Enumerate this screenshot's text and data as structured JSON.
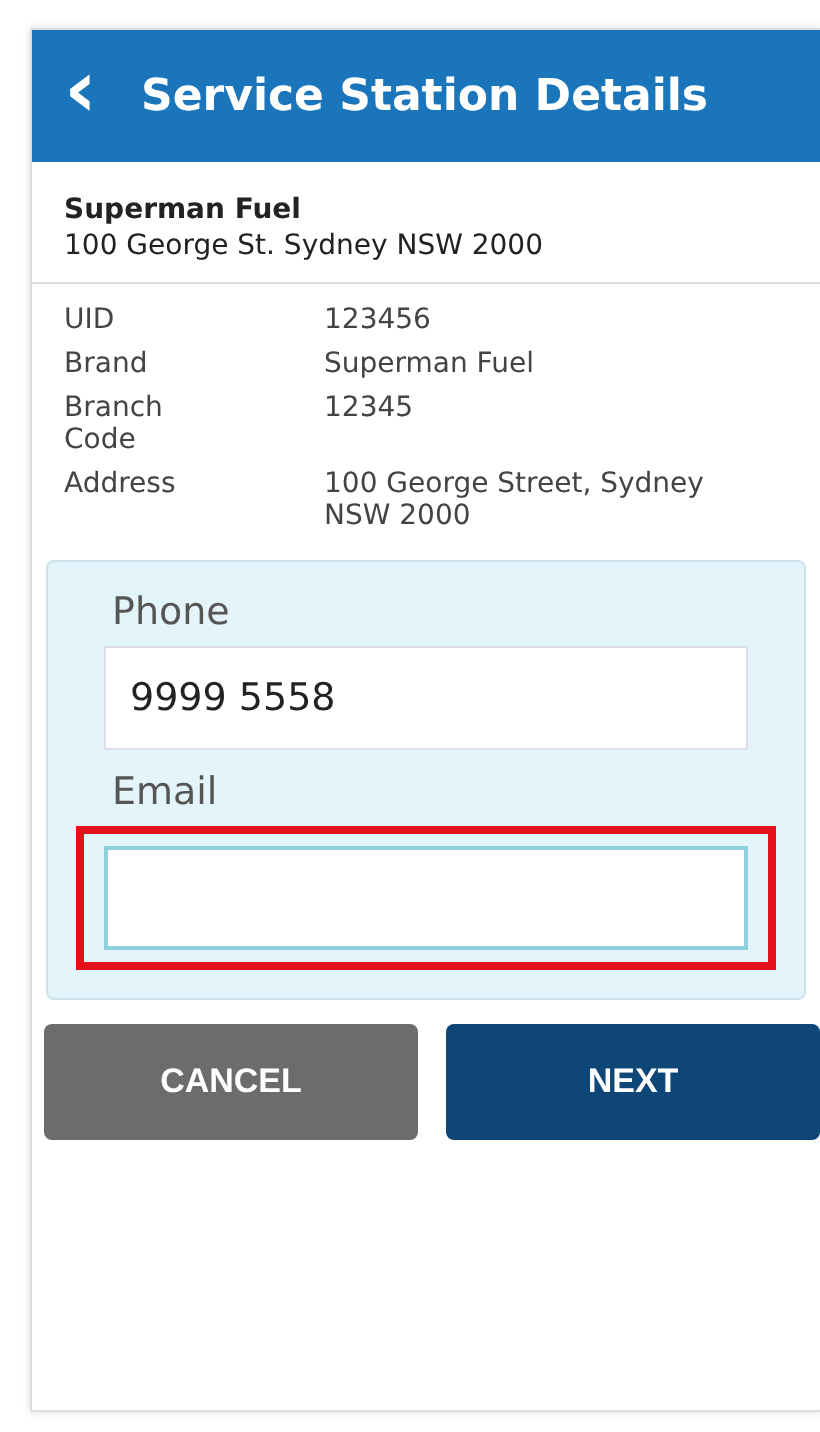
{
  "header": {
    "back_icon": "‹",
    "title": "Service Station Details"
  },
  "station": {
    "name": "Superman Fuel",
    "address": "100 George St. Sydney NSW 2000"
  },
  "details": [
    {
      "label": "UID",
      "value": "123456"
    },
    {
      "label": "Brand",
      "value": "Superman Fuel"
    },
    {
      "label": "Branch Code",
      "value": "12345"
    },
    {
      "label": "Address",
      "value": "100 George Street, Sydney NSW 2000"
    }
  ],
  "contact_fields": [
    {
      "label": "Phone",
      "value": "9999 5558",
      "highlighted": false
    },
    {
      "label": "Email",
      "highlighted": true
    }
  ],
  "buttons": [
    {
      "label": "CANCEL",
      "kind": "secondary"
    },
    {
      "label": "NEXT",
      "kind": "primary"
    }
  ]
}
